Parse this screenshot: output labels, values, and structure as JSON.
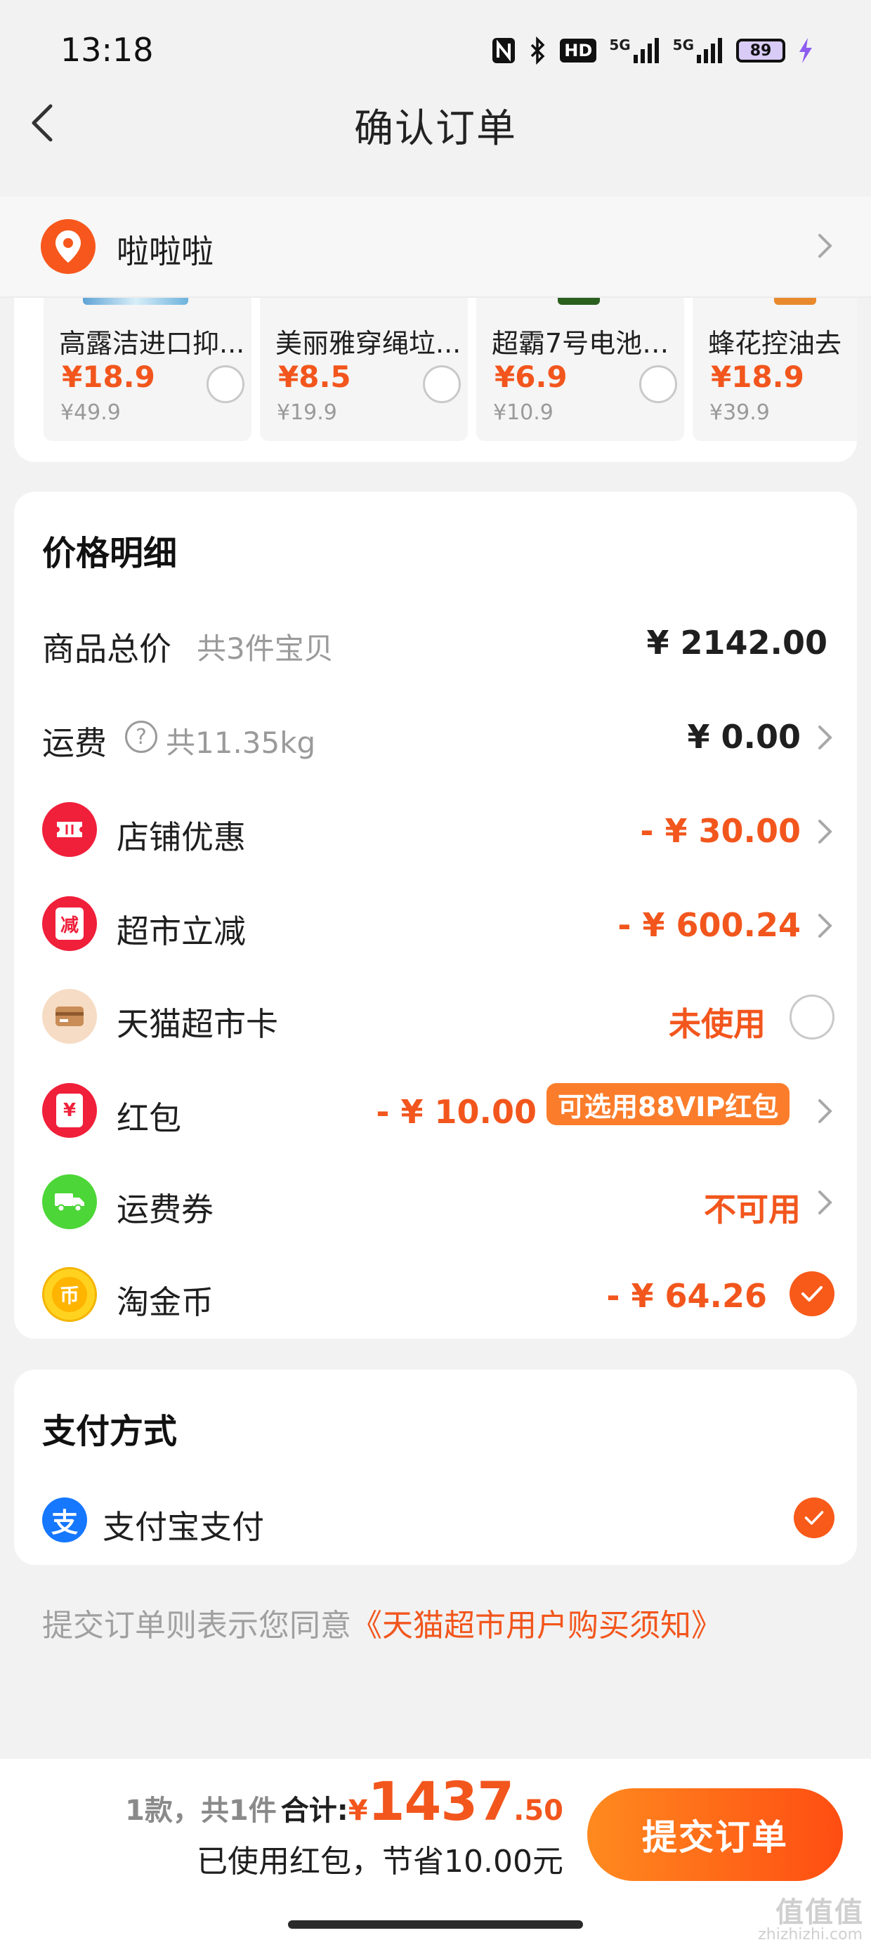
{
  "status_bar": {
    "time": "13:18",
    "signal1": "5G",
    "signal2": "5G",
    "battery": "89",
    "hd_label": "HD"
  },
  "nav": {
    "title": "确认订单"
  },
  "address": {
    "name": "啦啦啦"
  },
  "recommend": [
    {
      "name": "高露洁进口抑...",
      "price": "¥18.9",
      "original": "¥49.9"
    },
    {
      "name": "美丽雅穿绳垃...",
      "price": "¥8.5",
      "original": "¥19.9"
    },
    {
      "name": "超霸7号电池1...",
      "price": "¥6.9",
      "original": "¥10.9"
    },
    {
      "name": "蜂花控油去",
      "price": "¥18.9",
      "original": "¥39.9"
    }
  ],
  "price_detail": {
    "title": "价格明细",
    "goods_total": {
      "label": "商品总价",
      "sub": "共3件宝贝",
      "value": "¥ 2142.00"
    },
    "shipping": {
      "label": "运费",
      "help": "?",
      "sub": "共11.35kg",
      "value": "¥ 0.00"
    },
    "shop_discount": {
      "label": "店铺优惠",
      "value": "- ¥ 30.00"
    },
    "market_cut": {
      "label": "超市立减",
      "icon_text": "减",
      "value": "- ¥ 600.24"
    },
    "market_card": {
      "label": "天猫超市卡",
      "value": "未使用"
    },
    "red_packet": {
      "label": "红包",
      "icon_text": "¥",
      "value": "- ¥ 10.00",
      "tag": "可选用88VIP红包"
    },
    "shipping_coupon": {
      "label": "运费券",
      "value": "不可用"
    },
    "gold_coin": {
      "label": "淘金币",
      "icon_text": "币",
      "value": "- ¥ 64.26"
    }
  },
  "payment": {
    "title": "支付方式",
    "method": "支付宝支付",
    "method_icon": "支"
  },
  "agreement": {
    "prefix": "提交订单则表示您同意",
    "link": "《天猫超市用户购买须知》"
  },
  "bottom": {
    "count": "1款，共1件",
    "total_label": "合计:",
    "yen": "¥",
    "total_int": "1437",
    "total_dec": ".50",
    "saved": "已使用红包，节省10.00元",
    "submit": "提交订单"
  },
  "watermark": {
    "text": "值值值",
    "sub": "zhizhizhi.com"
  },
  "colors": {
    "accent": "#f2561d",
    "button_start": "#ff8a1f",
    "button_end": "#ff4d12",
    "tag": "#fb7d2c"
  }
}
